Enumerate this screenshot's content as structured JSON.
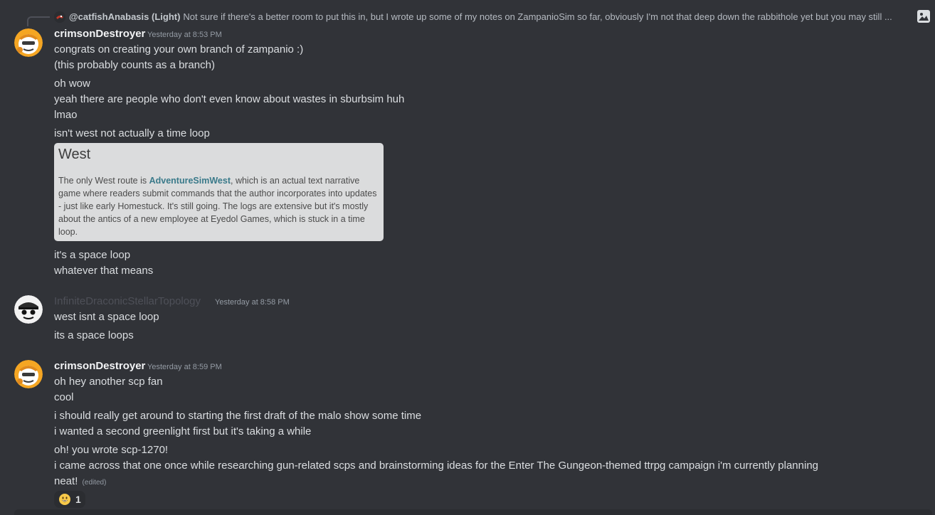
{
  "reply": {
    "author": "@catfishAnabasis (Light)",
    "text": "Not sure if there's a better room to put this in, but I wrote up some of my notes on ZampanioSim so far, obviously I'm not that deep down the rabbithole yet but you may still ..."
  },
  "groups": [
    {
      "author": "crimsonDestroyer",
      "timestamp": "Yesterday at 8:53 PM",
      "lines": [
        "congrats on creating your own branch of zampanio :)",
        "(this probably counts as a branch)",
        "oh wow",
        "yeah there are people who don't even know about wastes in sburbsim huh",
        "lmao",
        "isn't west not actually a time loop"
      ],
      "embed": {
        "title": "West",
        "body_before": "The only West route is ",
        "link": "AdventureSimWest",
        "body_after": ", which is an actual text narrative game where readers submit commands that the author incorporates into updates - just like early Homestuck. It's still going. The logs are extensive but it's mostly about the antics of a new employee at Eyedol Games, which is stuck in a time loop."
      },
      "lines_after": [
        "it's a space loop",
        "whatever that means"
      ]
    },
    {
      "author": "InfiniteDraconicStellarTopology",
      "timestamp": "Yesterday at 8:58 PM",
      "lines": [
        "west isnt a space loop",
        "its a space loops"
      ]
    },
    {
      "author": "crimsonDestroyer",
      "timestamp": "Yesterday at 8:59 PM",
      "lines": [
        "oh hey another scp fan",
        "cool",
        "i should really get around to starting the first draft of the malo show some time",
        "i wanted a second greenlight first but it's taking a while",
        "oh! you wrote scp-1270!",
        "i came across that one once while researching gun-related scps and brainstorming ideas for the Enter The Gungeon-themed ttrpg campaign i'm currently planning",
        "neat!"
      ],
      "edited_label": "(edited)",
      "reaction": {
        "emoji": "grinning-face",
        "count": "1"
      }
    }
  ],
  "colors": {
    "background": "#313338",
    "text": "#dbdee1",
    "username": "#f2f3f5",
    "timestamp": "#949ba4",
    "embed_bg": "#dbdcdd",
    "embed_link": "#3a7a8a"
  }
}
